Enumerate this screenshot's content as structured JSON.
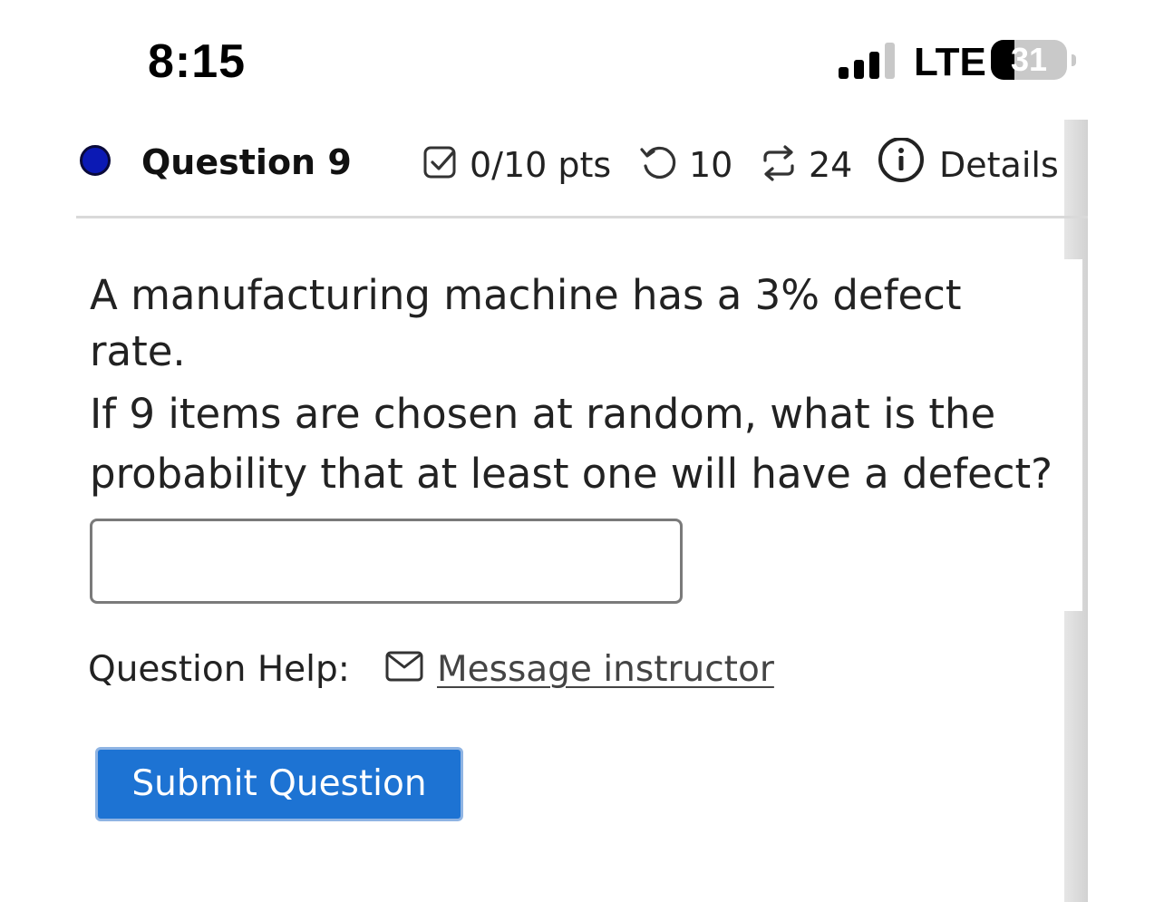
{
  "status_bar": {
    "time": "8:15",
    "network": "LTE",
    "battery_percent": "31",
    "signal_bars_active": 3,
    "signal_bars_total": 4,
    "battery_level": 0.31
  },
  "question": {
    "title": "Question 9",
    "score": "0/10 pts",
    "retries": "10",
    "attempts": "24",
    "details_label": "Details",
    "marker_color": "#0b19b4",
    "icons": {
      "score": "checkbox-icon",
      "retries": "undo-icon",
      "attempts": "repeat-icon",
      "details": "info-circle-icon"
    }
  },
  "prompt": {
    "line1": "A manufacturing machine has a 3% defect rate.",
    "line2": "If 9 items are chosen at random, what is the probability that at least one will have a defect?"
  },
  "answer": {
    "value": "",
    "placeholder": ""
  },
  "help": {
    "label": "Question Help:",
    "message_link": "Message instructor",
    "icon": "mail-icon"
  },
  "submit": {
    "label": "Submit Question",
    "color": "#1d73d3"
  }
}
